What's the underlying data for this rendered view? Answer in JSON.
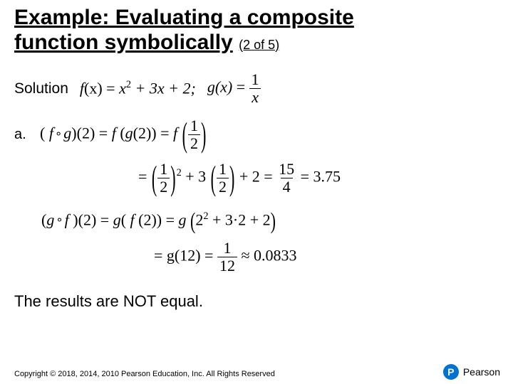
{
  "title": {
    "line1": "Example: Evaluating a composite",
    "line2": "function symbolically",
    "pager": "(2 of 5)"
  },
  "solution_label": "Solution",
  "fx_prefix": "f",
  "fx_var": "(x)",
  "eq": " = ",
  "fx_body": "x",
  "fx_sq": "2",
  "fx_rest": " + 3x + 2;",
  "gx_label": "g(x)",
  "frac_1_x": {
    "num": "1",
    "den": "x"
  },
  "part_a_label": "a.",
  "fog": "( f ∘ g )(2) = f ( g(2) ) = f",
  "half": {
    "num": "1",
    "den": "2"
  },
  "line2_prefix": "=",
  "plus3": " + 3",
  "plus2": " + 2 = ",
  "fifteen4": {
    "num": "15",
    "den": "4"
  },
  "eq375": " = 3.75",
  "gof": "( g ∘ f )(2) = g ( f (2) ) = g",
  "inner": "2",
  "inner_sq": "2",
  "inner_rest": " + 3·2 + 2",
  "line4_prefix": "= g(12) = ",
  "one12": {
    "num": "1",
    "den": "12"
  },
  "approx": " ≈ 0.0833",
  "conclusion": "The results are NOT equal.",
  "copyright": "Copyright © 2018, 2014, 2010 Pearson Education, Inc. All Rights Reserved",
  "brand": "Pearson",
  "brand_letter": "P"
}
